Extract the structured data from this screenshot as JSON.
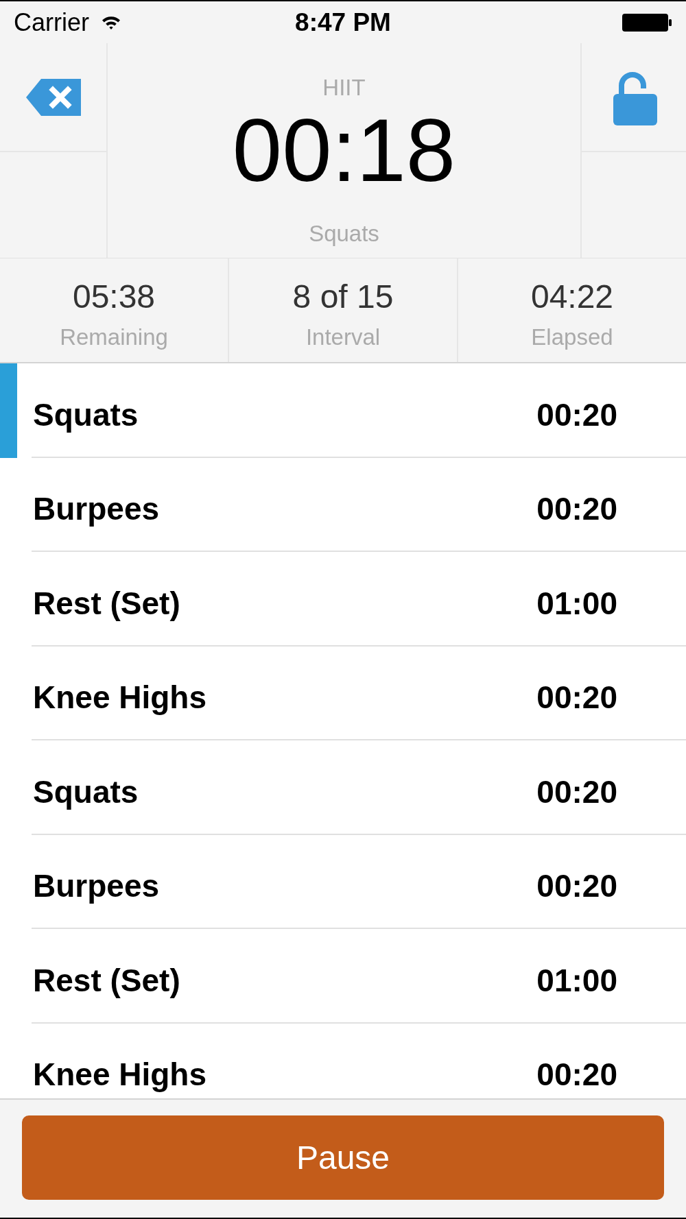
{
  "status_bar": {
    "carrier": "Carrier",
    "time": "8:47 PM"
  },
  "header": {
    "workout": "HIIT",
    "timer": "00:18",
    "current_exercise": "Squats"
  },
  "stats": [
    {
      "value": "05:38",
      "label": "Remaining"
    },
    {
      "value": "8 of 15",
      "label": "Interval"
    },
    {
      "value": "04:22",
      "label": "Elapsed"
    }
  ],
  "intervals": [
    {
      "name": "Squats",
      "duration": "00:20",
      "selected": true
    },
    {
      "name": "Burpees",
      "duration": "00:20",
      "selected": false
    },
    {
      "name": "Rest (Set)",
      "duration": "01:00",
      "selected": false
    },
    {
      "name": "Knee Highs",
      "duration": "00:20",
      "selected": false
    },
    {
      "name": "Squats",
      "duration": "00:20",
      "selected": false
    },
    {
      "name": "Burpees",
      "duration": "00:20",
      "selected": false
    },
    {
      "name": "Rest (Set)",
      "duration": "01:00",
      "selected": false
    },
    {
      "name": "Knee Highs",
      "duration": "00:20",
      "selected": false
    }
  ],
  "pause_button": {
    "label": "Pause"
  }
}
